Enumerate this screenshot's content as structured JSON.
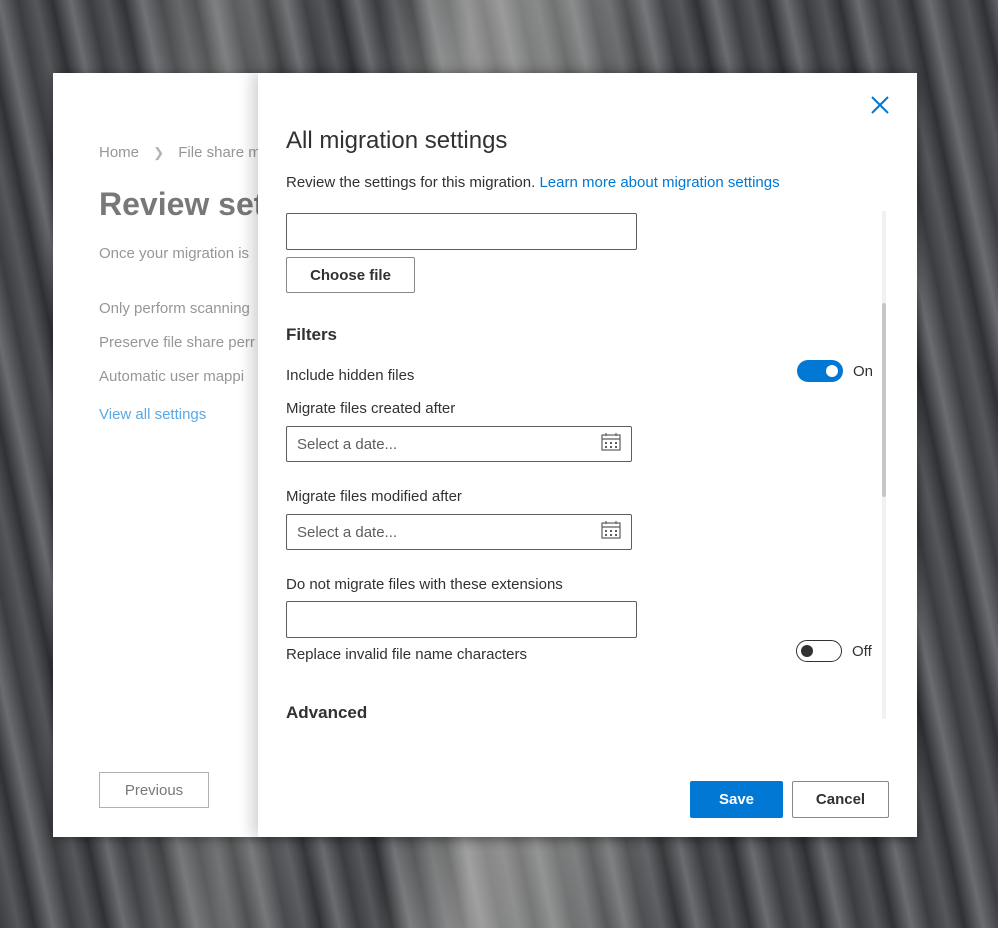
{
  "background": {
    "name": "rock-cliff-wallpaper"
  },
  "left_page": {
    "breadcrumb": [
      "Home",
      "File share m"
    ],
    "title": "Review sett",
    "description": "Once your migration is",
    "settings": [
      "Only perform scanning",
      "Preserve file share perr",
      "Automatic user mappi"
    ],
    "view_all_link": "View all settings",
    "previous_button": "Previous"
  },
  "panel": {
    "title": "All migration settings",
    "description": "Review the settings for this migration.",
    "learn_more_link": "Learn more about migration settings",
    "file_input_value": "",
    "choose_file_button": "Choose file",
    "filters_heading": "Filters",
    "include_hidden_files": {
      "label": "Include hidden files",
      "state": "On",
      "enabled": true
    },
    "created_after": {
      "label": "Migrate files created after",
      "placeholder": "Select a date..."
    },
    "modified_after": {
      "label": "Migrate files modified after",
      "placeholder": "Select a date..."
    },
    "extensions": {
      "label": "Do not migrate files with these extensions",
      "value": ""
    },
    "replace_invalid_chars": {
      "label": "Replace invalid file name characters",
      "state": "Off",
      "enabled": false
    },
    "advanced_heading": "Advanced",
    "save_button": "Save",
    "cancel_button": "Cancel"
  },
  "colors": {
    "accent": "#0078d4",
    "text": "#323130",
    "muted": "#605e5c"
  },
  "icons": [
    "close-icon",
    "chevron-right-icon",
    "calendar-icon"
  ]
}
